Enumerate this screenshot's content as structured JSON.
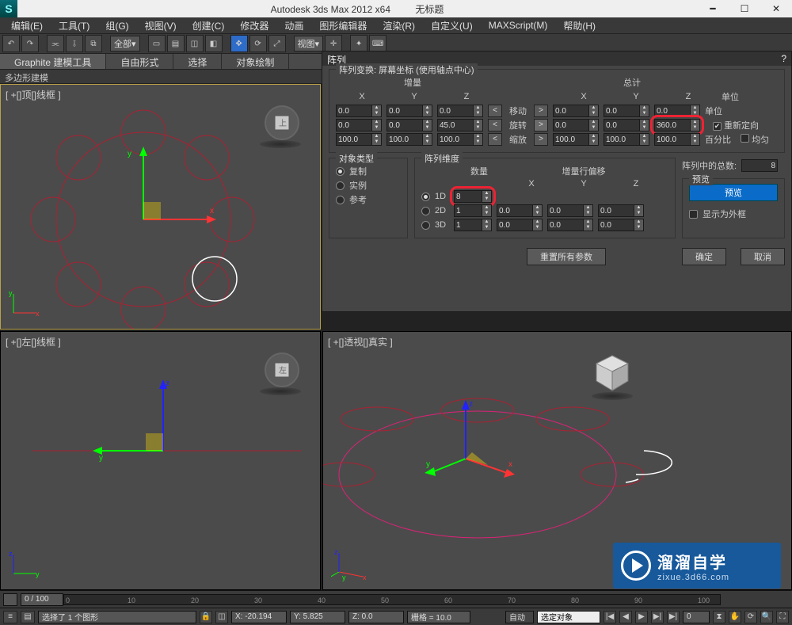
{
  "titlebar": {
    "app": "Autodesk 3ds Max  2012 x64",
    "doc": "无标题"
  },
  "menu": [
    "编辑(E)",
    "工具(T)",
    "组(G)",
    "视图(V)",
    "创建(C)",
    "修改器",
    "动画",
    "图形编辑器",
    "渲染(R)",
    "自定义(U)",
    "MAXScript(M)",
    "帮助(H)"
  ],
  "toolbar": {
    "filter": "全部",
    "viewsel": "视图"
  },
  "ribbon": {
    "tabs": [
      "Graphite 建模工具",
      "自由形式",
      "选择",
      "对象绘制"
    ],
    "sub": "多边形建模"
  },
  "viewports": {
    "tl": "[ +[]顶[]线框 ]",
    "tr": "",
    "bl": "[ +[]左[]线框 ]",
    "br": "[ +[]透视[]真实 ]"
  },
  "dialog": {
    "title": "阵列",
    "help": "?",
    "transform_label": "阵列变换: 屏幕坐标 (使用轴点中心)",
    "inc_label": "增量",
    "tot_label": "总计",
    "axes": [
      "X",
      "Y",
      "Z"
    ],
    "ops": [
      "移动",
      "旋转",
      "缩放"
    ],
    "unit_label": "单位",
    "pct_label": "百分比",
    "recenter_label": "重新定向",
    "uniform_label": "均匀",
    "inc": [
      [
        "0.0",
        "0.0",
        "0.0"
      ],
      [
        "0.0",
        "0.0",
        "45.0"
      ],
      [
        "100.0",
        "100.0",
        "100.0"
      ]
    ],
    "tot": [
      [
        "0.0",
        "0.0",
        "0.0"
      ],
      [
        "0.0",
        "0.0",
        "360.0"
      ],
      [
        "100.0",
        "100.0",
        "100.0"
      ]
    ],
    "objtype": {
      "legend": "对象类型",
      "opts": [
        "复制",
        "实例",
        "参考"
      ]
    },
    "dims": {
      "legend": "阵列维度",
      "count_label": "数量",
      "offset_label": "增量行偏移",
      "axes": [
        "X",
        "Y",
        "Z"
      ],
      "rows": [
        "1D",
        "2D",
        "3D"
      ],
      "count": [
        "8",
        "1",
        "1"
      ],
      "off": [
        [],
        [
          "0.0",
          "0.0",
          "0.0"
        ],
        [
          "0.0",
          "0.0",
          "0.0"
        ]
      ]
    },
    "total_label": "阵列中的总数:",
    "total_value": "8",
    "preview": {
      "legend": "预览",
      "btn": "预览",
      "wire": "显示为外框"
    },
    "reset": "重置所有参数",
    "ok": "确定",
    "cancel": "取消"
  },
  "timeline": {
    "range": "0 / 100",
    "cur": "0"
  },
  "status": {
    "sel": "选择了 1 个图形",
    "x": "X: -20.194",
    "y": "Y: 5.825",
    "z": "Z: 0.0",
    "grid": "栅格 = 10.0",
    "auto": "自动",
    "selset": "选定对象"
  },
  "watermark": {
    "big": "溜溜自学",
    "small": "zixue.3d66.com"
  }
}
